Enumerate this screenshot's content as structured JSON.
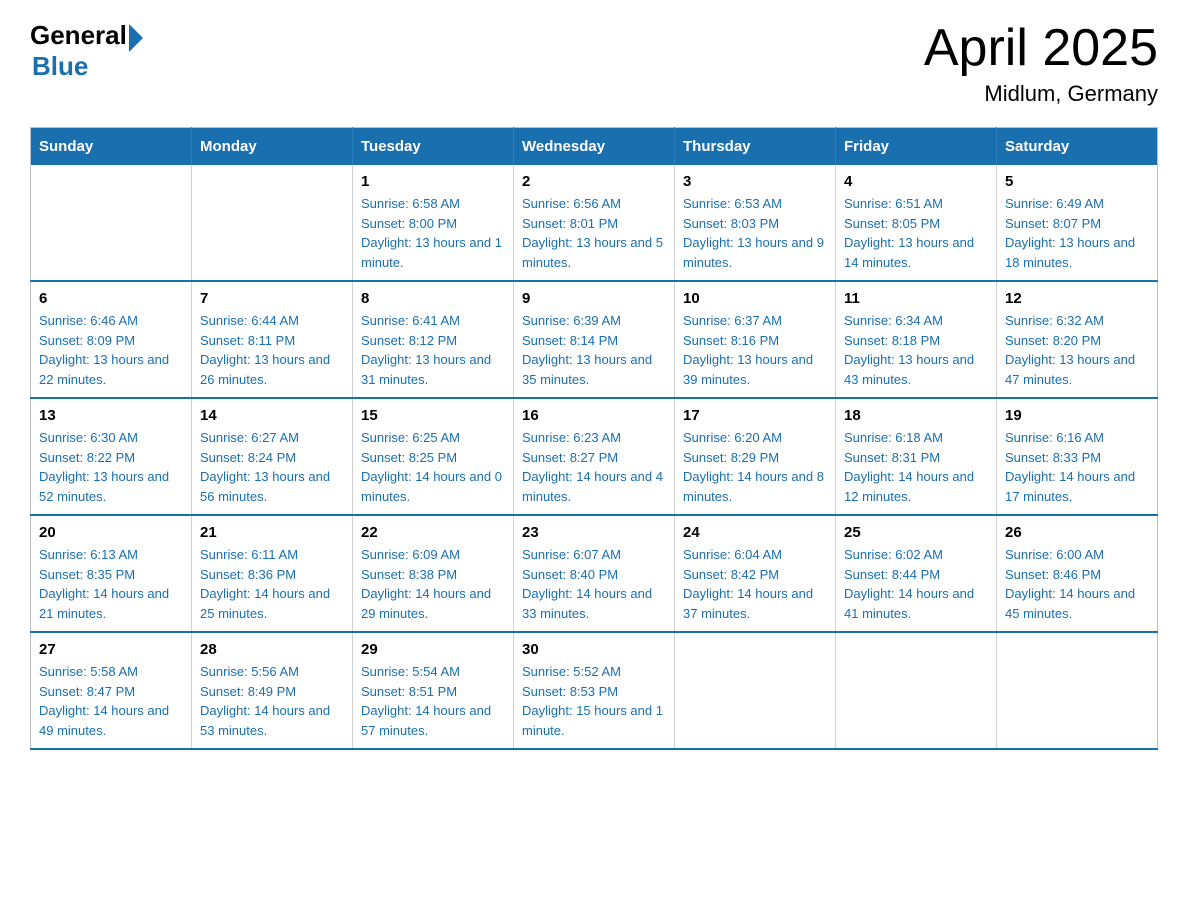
{
  "header": {
    "logo_general": "General",
    "logo_blue": "Blue",
    "title": "April 2025",
    "subtitle": "Midlum, Germany"
  },
  "calendar": {
    "days_of_week": [
      "Sunday",
      "Monday",
      "Tuesday",
      "Wednesday",
      "Thursday",
      "Friday",
      "Saturday"
    ],
    "weeks": [
      [
        {
          "date": "",
          "info": ""
        },
        {
          "date": "",
          "info": ""
        },
        {
          "date": "1",
          "info": "Sunrise: 6:58 AM\nSunset: 8:00 PM\nDaylight: 13 hours and 1 minute."
        },
        {
          "date": "2",
          "info": "Sunrise: 6:56 AM\nSunset: 8:01 PM\nDaylight: 13 hours and 5 minutes."
        },
        {
          "date": "3",
          "info": "Sunrise: 6:53 AM\nSunset: 8:03 PM\nDaylight: 13 hours and 9 minutes."
        },
        {
          "date": "4",
          "info": "Sunrise: 6:51 AM\nSunset: 8:05 PM\nDaylight: 13 hours and 14 minutes."
        },
        {
          "date": "5",
          "info": "Sunrise: 6:49 AM\nSunset: 8:07 PM\nDaylight: 13 hours and 18 minutes."
        }
      ],
      [
        {
          "date": "6",
          "info": "Sunrise: 6:46 AM\nSunset: 8:09 PM\nDaylight: 13 hours and 22 minutes."
        },
        {
          "date": "7",
          "info": "Sunrise: 6:44 AM\nSunset: 8:11 PM\nDaylight: 13 hours and 26 minutes."
        },
        {
          "date": "8",
          "info": "Sunrise: 6:41 AM\nSunset: 8:12 PM\nDaylight: 13 hours and 31 minutes."
        },
        {
          "date": "9",
          "info": "Sunrise: 6:39 AM\nSunset: 8:14 PM\nDaylight: 13 hours and 35 minutes."
        },
        {
          "date": "10",
          "info": "Sunrise: 6:37 AM\nSunset: 8:16 PM\nDaylight: 13 hours and 39 minutes."
        },
        {
          "date": "11",
          "info": "Sunrise: 6:34 AM\nSunset: 8:18 PM\nDaylight: 13 hours and 43 minutes."
        },
        {
          "date": "12",
          "info": "Sunrise: 6:32 AM\nSunset: 8:20 PM\nDaylight: 13 hours and 47 minutes."
        }
      ],
      [
        {
          "date": "13",
          "info": "Sunrise: 6:30 AM\nSunset: 8:22 PM\nDaylight: 13 hours and 52 minutes."
        },
        {
          "date": "14",
          "info": "Sunrise: 6:27 AM\nSunset: 8:24 PM\nDaylight: 13 hours and 56 minutes."
        },
        {
          "date": "15",
          "info": "Sunrise: 6:25 AM\nSunset: 8:25 PM\nDaylight: 14 hours and 0 minutes."
        },
        {
          "date": "16",
          "info": "Sunrise: 6:23 AM\nSunset: 8:27 PM\nDaylight: 14 hours and 4 minutes."
        },
        {
          "date": "17",
          "info": "Sunrise: 6:20 AM\nSunset: 8:29 PM\nDaylight: 14 hours and 8 minutes."
        },
        {
          "date": "18",
          "info": "Sunrise: 6:18 AM\nSunset: 8:31 PM\nDaylight: 14 hours and 12 minutes."
        },
        {
          "date": "19",
          "info": "Sunrise: 6:16 AM\nSunset: 8:33 PM\nDaylight: 14 hours and 17 minutes."
        }
      ],
      [
        {
          "date": "20",
          "info": "Sunrise: 6:13 AM\nSunset: 8:35 PM\nDaylight: 14 hours and 21 minutes."
        },
        {
          "date": "21",
          "info": "Sunrise: 6:11 AM\nSunset: 8:36 PM\nDaylight: 14 hours and 25 minutes."
        },
        {
          "date": "22",
          "info": "Sunrise: 6:09 AM\nSunset: 8:38 PM\nDaylight: 14 hours and 29 minutes."
        },
        {
          "date": "23",
          "info": "Sunrise: 6:07 AM\nSunset: 8:40 PM\nDaylight: 14 hours and 33 minutes."
        },
        {
          "date": "24",
          "info": "Sunrise: 6:04 AM\nSunset: 8:42 PM\nDaylight: 14 hours and 37 minutes."
        },
        {
          "date": "25",
          "info": "Sunrise: 6:02 AM\nSunset: 8:44 PM\nDaylight: 14 hours and 41 minutes."
        },
        {
          "date": "26",
          "info": "Sunrise: 6:00 AM\nSunset: 8:46 PM\nDaylight: 14 hours and 45 minutes."
        }
      ],
      [
        {
          "date": "27",
          "info": "Sunrise: 5:58 AM\nSunset: 8:47 PM\nDaylight: 14 hours and 49 minutes."
        },
        {
          "date": "28",
          "info": "Sunrise: 5:56 AM\nSunset: 8:49 PM\nDaylight: 14 hours and 53 minutes."
        },
        {
          "date": "29",
          "info": "Sunrise: 5:54 AM\nSunset: 8:51 PM\nDaylight: 14 hours and 57 minutes."
        },
        {
          "date": "30",
          "info": "Sunrise: 5:52 AM\nSunset: 8:53 PM\nDaylight: 15 hours and 1 minute."
        },
        {
          "date": "",
          "info": ""
        },
        {
          "date": "",
          "info": ""
        },
        {
          "date": "",
          "info": ""
        }
      ]
    ]
  }
}
